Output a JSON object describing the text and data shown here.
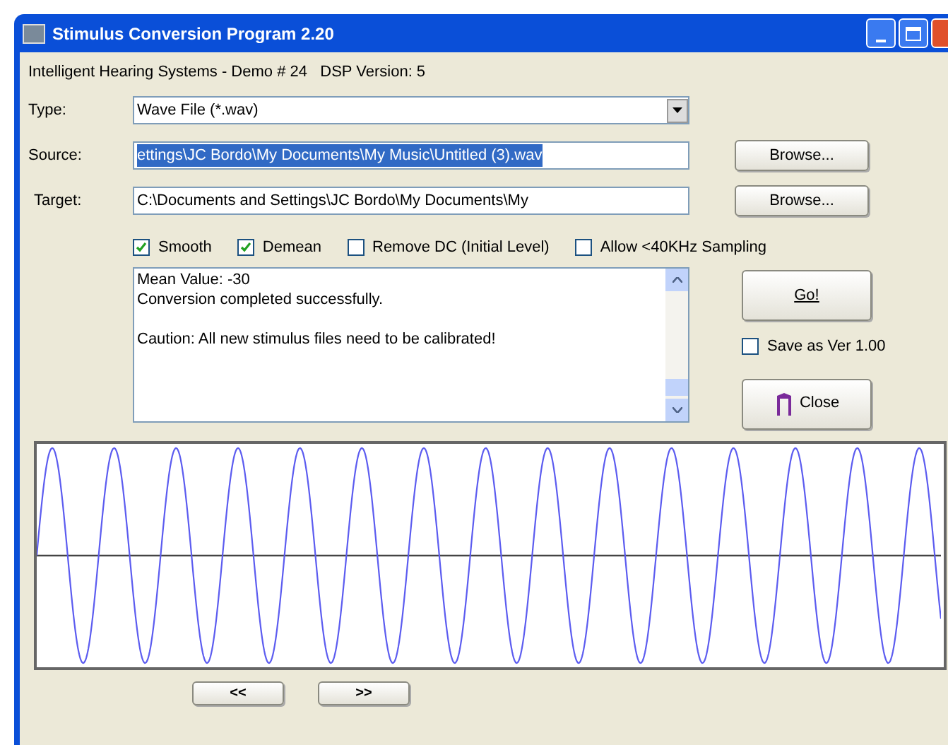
{
  "window": {
    "title": "Stimulus Conversion Program 2.20"
  },
  "header": "Intelligent Hearing Systems - Demo # 24   DSP Version: 5",
  "type": {
    "label": "Type:",
    "value": "Wave File (*.wav)"
  },
  "source": {
    "label": "Source:",
    "value": "ettings\\JC Bordo\\My Documents\\My Music\\Untitled (3).wav",
    "button": "Browse..."
  },
  "target": {
    "label": "Target:",
    "value": "C:\\Documents and Settings\\JC Bordo\\My Documents\\My",
    "button": "Browse..."
  },
  "options": [
    {
      "label": "Smooth",
      "checked": true
    },
    {
      "label": "Demean",
      "checked": true
    },
    {
      "label": "Remove DC (Initial Level)",
      "checked": false
    },
    {
      "label": "Allow <40KHz Sampling",
      "checked": false
    }
  ],
  "log": [
    {
      "lines": [
        "Mean Value: -30",
        "Conversion completed successfully."
      ]
    },
    {
      "lines": [
        "Caution: All new stimulus files need to be calibrated!"
      ]
    }
  ],
  "go_button": "Go!",
  "save_as": {
    "label": "Save as Ver 1.00",
    "checked": false
  },
  "close_button": "Close",
  "nav_buttons": [
    "<<",
    ">>"
  ]
}
